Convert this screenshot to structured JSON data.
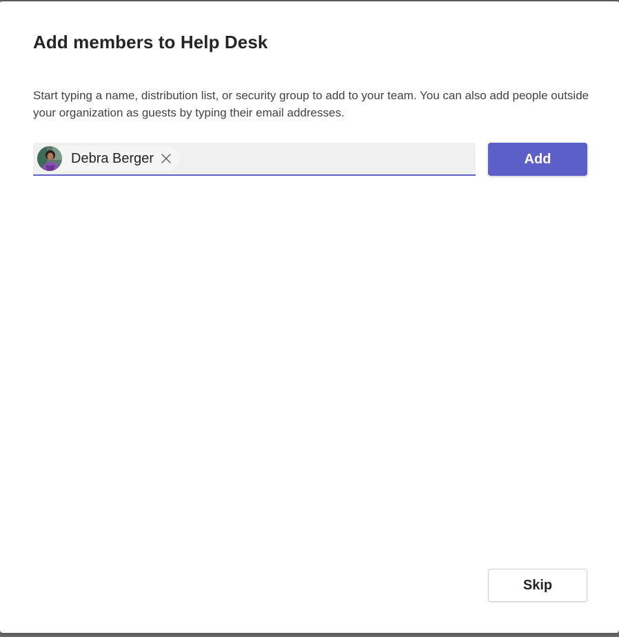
{
  "dialog": {
    "title": "Add members to Help Desk",
    "description": "Start typing a name, distribution list, or security group to add to your team. You can also add people outside your organization as guests by typing their email addresses."
  },
  "people_picker": {
    "selected": [
      {
        "name": "Debra Berger",
        "avatar_icon": "user-photo-avatar",
        "remove_icon": "close-icon"
      }
    ],
    "input_value": "",
    "accent_color": "#5b5fc7"
  },
  "buttons": {
    "add_label": "Add",
    "skip_label": "Skip"
  },
  "colors": {
    "primary": "#5b5fc7",
    "background": "#ffffff",
    "input_background": "#f0f0f0",
    "text": "#242424"
  }
}
